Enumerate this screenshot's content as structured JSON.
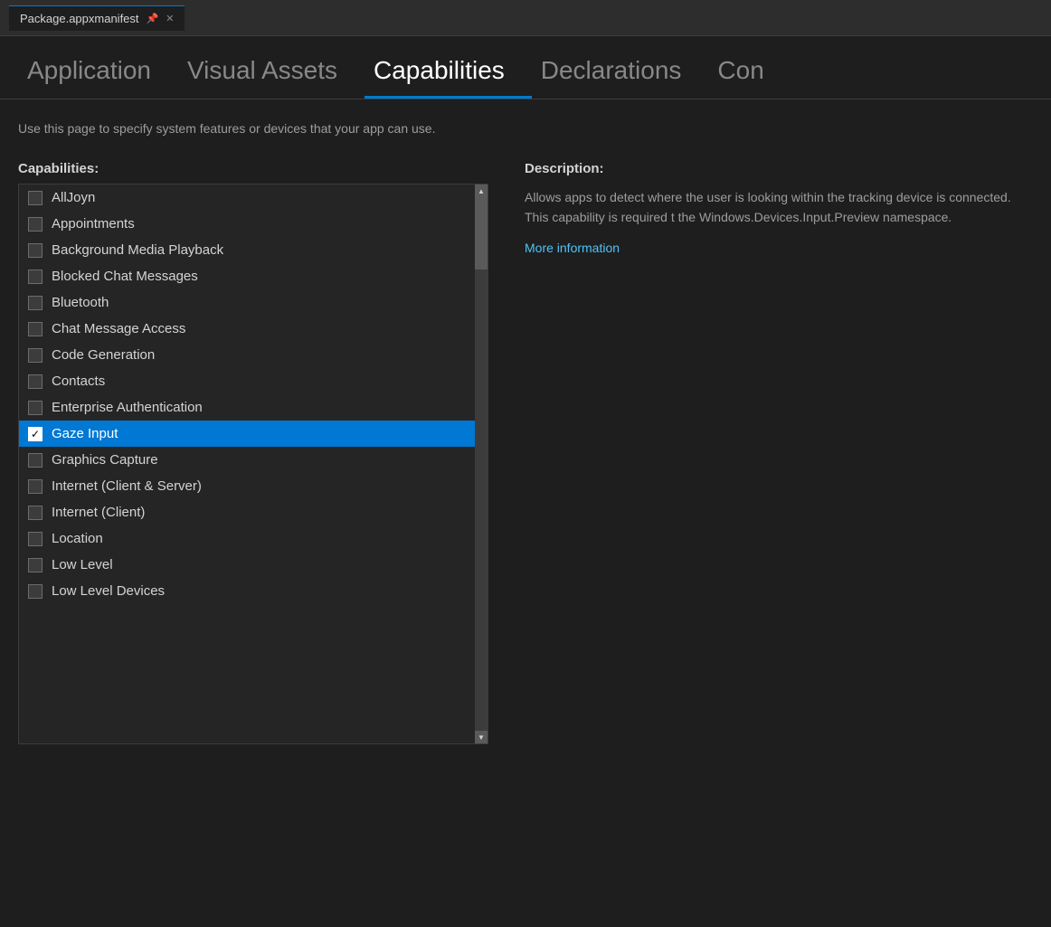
{
  "titlebar": {
    "tab_label": "Package.appxmanifest",
    "pin_icon": "📌",
    "close_icon": "×"
  },
  "nav": {
    "tabs": [
      {
        "id": "application",
        "label": "Application",
        "active": false
      },
      {
        "id": "visual-assets",
        "label": "Visual Assets",
        "active": false
      },
      {
        "id": "capabilities",
        "label": "Capabilities",
        "active": true
      },
      {
        "id": "declarations",
        "label": "Declarations",
        "active": false
      },
      {
        "id": "con",
        "label": "Con",
        "active": false
      }
    ]
  },
  "page": {
    "description": "Use this page to specify system features or devices that your app can use."
  },
  "capabilities_panel": {
    "title": "Capabilities:",
    "items": [
      {
        "id": "alljoyn",
        "label": "AllJoyn",
        "checked": false,
        "selected": false
      },
      {
        "id": "appointments",
        "label": "Appointments",
        "checked": false,
        "selected": false
      },
      {
        "id": "background-media-playback",
        "label": "Background Media Playback",
        "checked": false,
        "selected": false
      },
      {
        "id": "blocked-chat-messages",
        "label": "Blocked Chat Messages",
        "checked": false,
        "selected": false
      },
      {
        "id": "bluetooth",
        "label": "Bluetooth",
        "checked": false,
        "selected": false
      },
      {
        "id": "chat-message-access",
        "label": "Chat Message Access",
        "checked": false,
        "selected": false
      },
      {
        "id": "code-generation",
        "label": "Code Generation",
        "checked": false,
        "selected": false
      },
      {
        "id": "contacts",
        "label": "Contacts",
        "checked": false,
        "selected": false
      },
      {
        "id": "enterprise-authentication",
        "label": "Enterprise Authentication",
        "checked": false,
        "selected": false
      },
      {
        "id": "gaze-input",
        "label": "Gaze Input",
        "checked": true,
        "selected": true
      },
      {
        "id": "graphics-capture",
        "label": "Graphics Capture",
        "checked": false,
        "selected": false
      },
      {
        "id": "internet-client-server",
        "label": "Internet (Client & Server)",
        "checked": false,
        "selected": false
      },
      {
        "id": "internet-client",
        "label": "Internet (Client)",
        "checked": false,
        "selected": false
      },
      {
        "id": "location",
        "label": "Location",
        "checked": false,
        "selected": false
      },
      {
        "id": "low-level",
        "label": "Low Level",
        "checked": false,
        "selected": false
      },
      {
        "id": "low-level-devices",
        "label": "Low Level Devices",
        "checked": false,
        "selected": false
      }
    ]
  },
  "description_panel": {
    "title": "Description:",
    "text": "Allows apps to detect where the user is looking within the tracking device is connected. This capability is required t the Windows.Devices.Input.Preview namespace.",
    "more_info_label": "More information"
  }
}
